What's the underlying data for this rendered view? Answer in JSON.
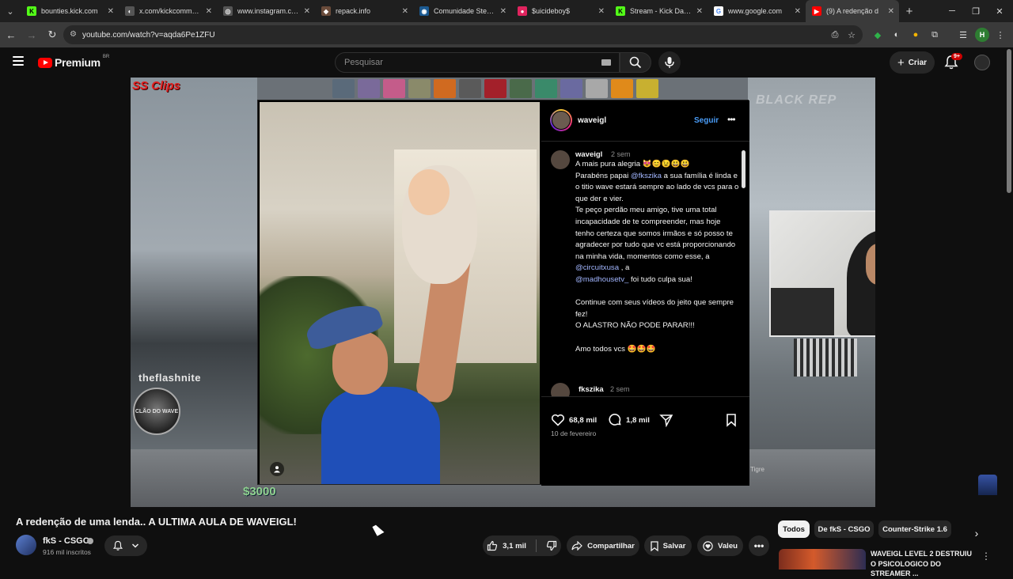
{
  "browser": {
    "tabs": [
      {
        "title": "bounties.kick.com",
        "fav": "K",
        "fav_color": "#53fc18",
        "fav_text": "#000"
      },
      {
        "title": "x.com/kickcommunity",
        "fav": "◐",
        "fav_color": "#555555",
        "fav_text": "#fff"
      },
      {
        "title": "www.instagram.com",
        "fav": "◎",
        "fav_color": "#555555",
        "fav_text": "#fff"
      },
      {
        "title": "repack.info",
        "fav": "◆",
        "fav_color": "#6a4b3a",
        "fav_text": "#fff"
      },
      {
        "title": "Comunidade Steam ::",
        "fav": "◉",
        "fav_color": "#1b5a92",
        "fav_text": "#fff"
      },
      {
        "title": "$uicideboy$",
        "fav": "●",
        "fav_color": "#e0245e",
        "fav_text": "#fff"
      },
      {
        "title": "Stream - Kick Dashbo",
        "fav": "K",
        "fav_color": "#53fc18",
        "fav_text": "#000"
      },
      {
        "title": "www.google.com",
        "fav": "G",
        "fav_color": "#ffffff",
        "fav_text": "#4285f4"
      },
      {
        "title": "(9) A redenção d",
        "fav": "▶",
        "fav_color": "#ff0000",
        "fav_text": "#fff"
      }
    ],
    "url": "youtube.com/watch?v=aqda6Pe1ZFU"
  },
  "youtube": {
    "logo_word": "Premium",
    "logo_region": "BR",
    "search_placeholder": "Pesquisar",
    "create_label": "Criar",
    "notif_count": "9+"
  },
  "player": {
    "overlay_ssclips": "SS Clips",
    "overlay_blackrep": "BLACK REP",
    "overlay_streamer": "theflashnite",
    "overlay_avatar_text": "CLÃO DO WAVE",
    "hud_money": "$3000",
    "hud_tigre": "Tigre"
  },
  "instagram": {
    "username": "waveigl",
    "follow_label": "Seguir",
    "comment1": {
      "user": "waveigl",
      "time": "2 sem",
      "lines": [
        {
          "pre": "A mais pura alegria 😻😊😉😃😃",
          "mention": "",
          "post": ""
        },
        {
          "pre": "Parabéns papai ",
          "mention": "@fkszika",
          "post": " a sua família é linda e o titio wave estará sempre ao lado de vcs para o que der e vier."
        },
        {
          "pre": "Te peço perdão meu amigo, tive uma total incapacidade de te compreender, mas hoje tenho certeza que somos irmãos e só posso te agradecer por tudo que vc está proporcionando na minha vida, momentos como esse, a ",
          "mention": "@circuitxusa",
          "post": " , a "
        },
        {
          "pre": "",
          "mention": "@madhousetv_",
          "post": " foi tudo culpa sua!"
        },
        {
          "pre": "",
          "mention": "",
          "post": ""
        },
        {
          "pre": "Continue com seus vídeos do jeito que sempre fez!",
          "mention": "",
          "post": ""
        },
        {
          "pre": "O ALASTRO NÃO PODE PARAR!!!",
          "mention": "",
          "post": ""
        },
        {
          "pre": "",
          "mention": "",
          "post": ""
        },
        {
          "pre": "Amo todos vcs 🤩🤩🤩",
          "mention": "",
          "post": ""
        }
      ]
    },
    "comment2": {
      "user": "fkszika",
      "time": "2 sem"
    },
    "likes": "68,8 mil",
    "comments": "1,8 mil",
    "date": "10 de fevereiro"
  },
  "video": {
    "title": "A redenção de uma lenda.. A ULTIMA AULA DE WAVEIGL!",
    "channel": "fkS - CSGO",
    "subscribers": "916 mil inscritos",
    "likes": "3,1 mil",
    "share_label": "Compartilhar",
    "save_label": "Salvar",
    "thanks_label": "Valeu"
  },
  "chips": [
    "Todos",
    "De fkS - CSGO",
    "Counter-Strike 1.6"
  ],
  "recommendation": {
    "title": "WAVEIGL LEVEL 2 DESTRUIU O PSICOLOGICO DO STREAMER ..."
  }
}
